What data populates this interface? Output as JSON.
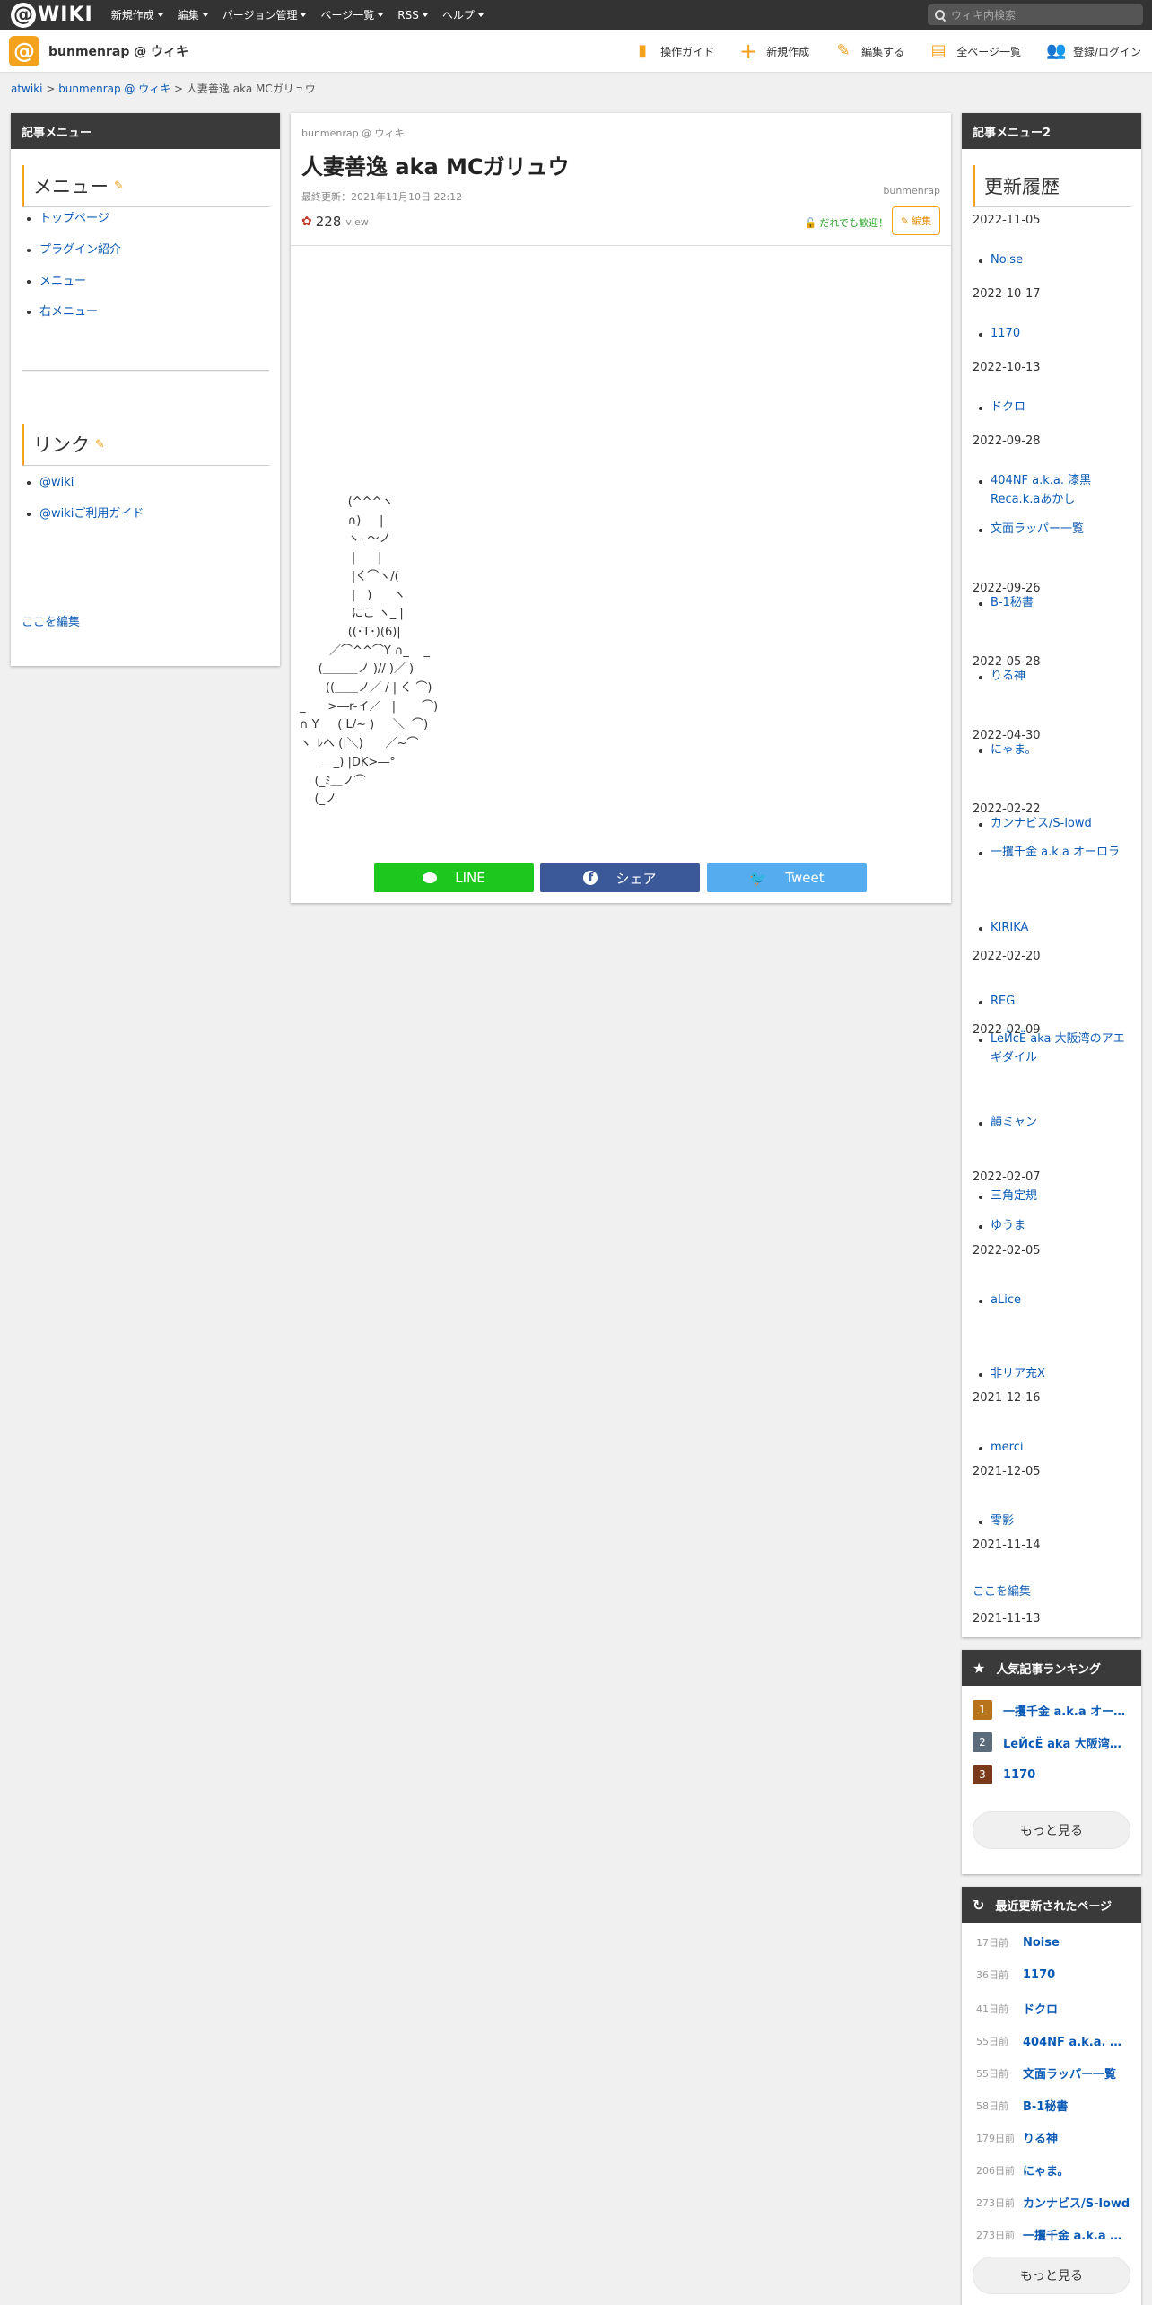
{
  "topbar": {
    "logo_text": "WIKI",
    "nav": [
      "新規作成",
      "編集",
      "バージョン管理",
      "ページ一覧",
      "RSS",
      "ヘルプ"
    ],
    "search_placeholder": "ウィキ内検索"
  },
  "site": {
    "title": "bunmenrap @ ウィキ",
    "actions": [
      {
        "label": "操作ガイド",
        "icon": "guide-icon"
      },
      {
        "label": "新規作成",
        "icon": "plus-icon"
      },
      {
        "label": "編集する",
        "icon": "pencil-icon"
      },
      {
        "label": "全ページ一覧",
        "icon": "document-icon"
      },
      {
        "label": "登録/ログイン",
        "icon": "users-icon"
      }
    ]
  },
  "breadcrumb": {
    "root": "atwiki",
    "sep1": " > ",
    "site": "bunmenrap @ ウィキ",
    "sep2": " > ",
    "current": "人妻善逸 aka MCガリュウ"
  },
  "left_menu": {
    "header": "記事メニュー",
    "menu_title": "メニュー",
    "menu_items": [
      "トップページ",
      "プラグイン紹介",
      "メニュー",
      "右メニュー"
    ],
    "link_title": "リンク",
    "link_items": [
      "@wiki",
      "@wikiご利用ガイド"
    ],
    "edit_here": "ここを編集"
  },
  "article": {
    "site_name": "bunmenrap @ ウィキ",
    "title": "人妻善逸 aka MCガリュウ",
    "updated": "最終更新：2021年11月10日 22:12",
    "author": "bunmenrap",
    "views": "228",
    "views_unit": "view",
    "welcome": "だれでも歓迎！",
    "edit_label": "編集",
    "ascii_art": [
      "             (^^^ヽ",
      "             ∩)     |",
      "             ヽ- ～ノ",
      "              |      |",
      "              |く⌒ヽ/(",
      "              |＿)      ヽ",
      "              にこ ヽ_ |",
      "             ((･T･)(6)|",
      "        ／⌒^^⌒Y ∩_    _",
      "     (＿＿＿ノ )// )／ )",
      "       ((＿＿ノ／ / | く ⌒)",
      "_      >―r-イ／   |       ⌒)",
      "∩ Y     ( L/~ )     ＼  ⌒)",
      "ヽ_ﾚへ (|＼)      ／~⌒",
      "      ＿_) |DK>―°",
      "    (_ﾐ＿ノ⌒",
      "    (_ノ"
    ],
    "share": {
      "line": "LINE",
      "facebook": "シェア",
      "twitter": "Tweet"
    }
  },
  "right_menu": {
    "header": "記事メニュー2",
    "history_title": "更新履歴",
    "history": [
      {
        "date": "2022-11-05",
        "items": [
          "Noise"
        ]
      },
      {
        "date": "2022-10-17",
        "items": [
          "1170"
        ]
      },
      {
        "date": "2022-10-13",
        "items": [
          "ドクロ"
        ]
      },
      {
        "date": "2022-09-28",
        "items": [
          "404NF a.k.a. 漆黒Reca.k.aあかし",
          "文面ラッパー一覧"
        ]
      },
      {
        "date": "2022-09-26",
        "items": [
          "B-1秘書"
        ]
      },
      {
        "date": "2022-05-28",
        "items": [
          "りる神"
        ]
      },
      {
        "date": "2022-04-30",
        "items": [
          "にゃま。"
        ]
      },
      {
        "date": "2022-02-22",
        "items": [
          "カンナビス/S-lowd",
          "一攫千金 a.k.a オーロラ"
        ]
      },
      {
        "date": "2022-02-20",
        "items": [
          "KIRIKA"
        ]
      },
      {
        "date": "2022-02-09",
        "items": [
          "REG",
          "LeЙcЁ aka 大阪湾のアエギダイル"
        ]
      },
      {
        "date": "2022-02-07",
        "items": [
          "韻ミャン"
        ]
      },
      {
        "date": "2022-02-05",
        "items": [
          "三角定規",
          "ゆうま"
        ]
      },
      {
        "date": "2021-12-16",
        "items": [
          "aLice"
        ]
      },
      {
        "date": "2021-12-05",
        "items": [
          "非リア充X"
        ]
      },
      {
        "date": "2021-11-14",
        "items": [
          "merci"
        ]
      },
      {
        "date": "2021-11-13",
        "items": [
          "零影"
        ]
      }
    ],
    "edit_here": "ここを編集"
  },
  "ranking": {
    "header": "人気記事ランキング",
    "items": [
      {
        "rank": "1",
        "label": "一攫千金 a.k.a オーロラ",
        "color": "#b8741a"
      },
      {
        "rank": "2",
        "label": "LeЙcЁ aka 大阪湾のアエギダイル",
        "color": "#5c6b7a"
      },
      {
        "rank": "3",
        "label": "1170",
        "color": "#7a3a1a"
      }
    ],
    "more": "もっと見る"
  },
  "recent": {
    "header": "最近更新されたページ",
    "items": [
      {
        "ago": "17日前",
        "label": "Noise"
      },
      {
        "ago": "36日前",
        "label": "1170"
      },
      {
        "ago": "41日前",
        "label": "ドクロ"
      },
      {
        "ago": "55日前",
        "label": "404NF a.k.a. 漆黒Reca.k.aあかし"
      },
      {
        "ago": "55日前",
        "label": "文面ラッパー一覧"
      },
      {
        "ago": "58日前",
        "label": "B-1秘書"
      },
      {
        "ago": "179日前",
        "label": "りる神"
      },
      {
        "ago": "206日前",
        "label": "にゃま。"
      },
      {
        "ago": "273日前",
        "label": "カンナビス/S-lowd"
      },
      {
        "ago": "273日前",
        "label": "一攫千金 a.k.a オーロラ"
      }
    ],
    "more": "もっと見る"
  },
  "colors": {
    "accent": "#f4a11c",
    "link": "#0b5ab5",
    "topbar": "#333333",
    "panel_head": "#3a3a3a"
  }
}
